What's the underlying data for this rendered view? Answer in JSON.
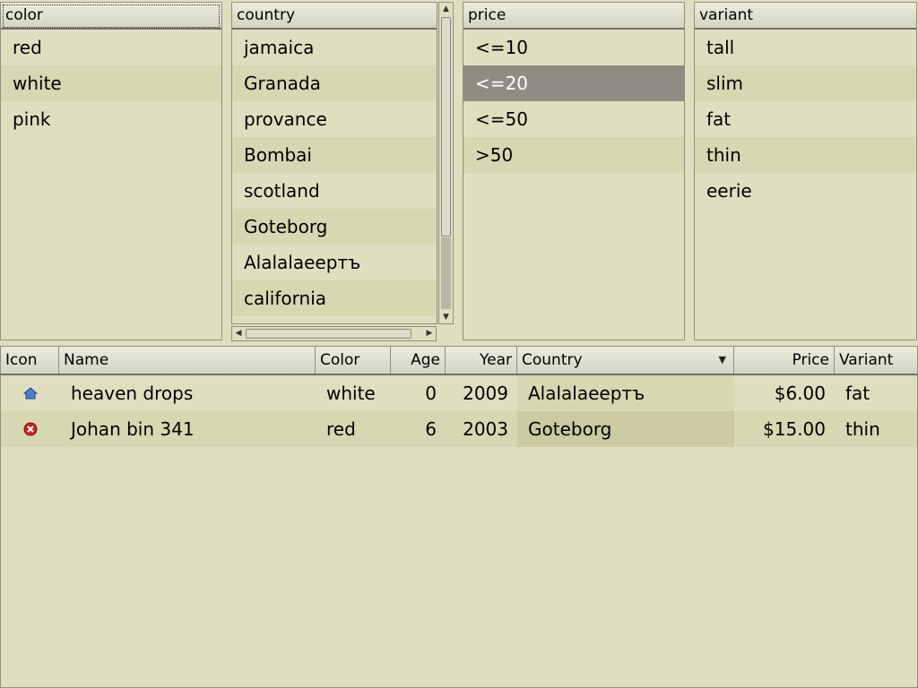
{
  "filters": [
    {
      "header": "color",
      "items": [
        "red",
        "white",
        "pink"
      ]
    },
    {
      "header": "country",
      "items": [
        "jamaica",
        "Granada",
        "provance",
        "Bombai",
        "scotland",
        "Goteborg",
        "Alalalaeертъ",
        "california"
      ]
    },
    {
      "header": "price",
      "items": [
        "<=10",
        "<=20",
        "<=50",
        ">50"
      ],
      "selected_index": 1
    },
    {
      "header": "variant",
      "items": [
        "tall",
        "slim",
        "fat",
        "thin",
        "eerie"
      ]
    }
  ],
  "table": {
    "columns": [
      "Icon",
      "Name",
      "Color",
      "Age",
      "Year",
      "Country",
      "Price",
      "Variant"
    ],
    "sorted_column": "Country",
    "rows": [
      {
        "icon": "home-icon",
        "name": "heaven drops",
        "color": "white",
        "age": "0",
        "year": "2009",
        "country": "Alalalaeертъ",
        "price": "$6.00",
        "variant": "fat"
      },
      {
        "icon": "error-icon",
        "name": "Johan bin 341",
        "color": "red",
        "age": "6",
        "year": "2003",
        "country": "Goteborg",
        "price": "$15.00",
        "variant": "thin"
      }
    ]
  },
  "colors": {
    "background": "#dfdfbf",
    "alt_row": "#d7d7b1",
    "selected": "#8f8c84",
    "error_icon": "#cc2222",
    "home_icon": "#4a7fcf"
  }
}
